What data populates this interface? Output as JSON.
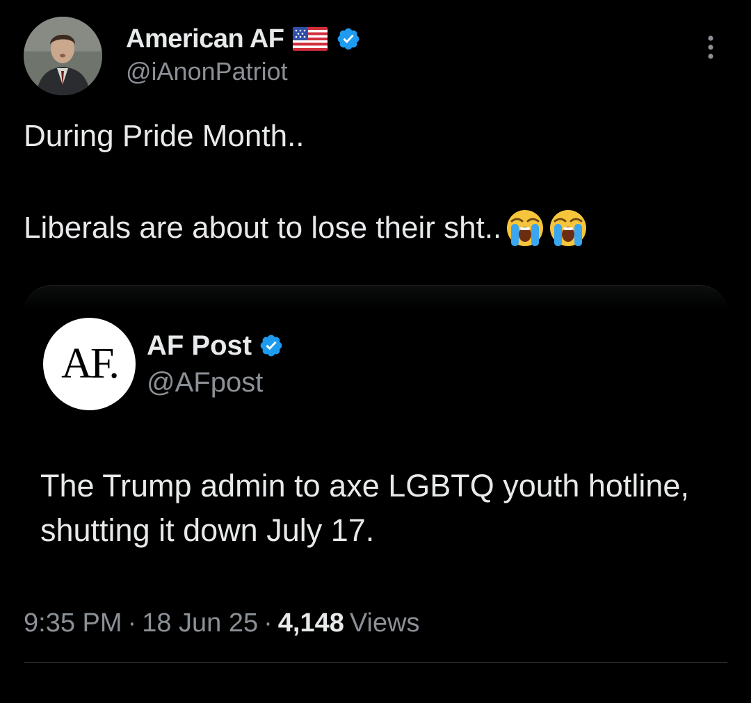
{
  "tweet": {
    "author": {
      "display_name": "American AF",
      "flag_icon": "us-flag-icon",
      "verified_icon": "verified-badge-icon",
      "handle": "@iAnonPatriot",
      "avatar_icon": "profile-photo"
    },
    "more_icon": "more-vertical-icon",
    "text_line_1": "During Pride Month..",
    "text_line_2": "Liberals are about to lose their sht..",
    "emoji": [
      "loudly-crying-face-icon",
      "loudly-crying-face-icon"
    ],
    "quoted": {
      "avatar_text": "AF.",
      "display_name": "AF Post",
      "verified_icon": "verified-badge-icon",
      "handle": "@AFpost",
      "text": "The Trump admin to axe LGBTQ youth hotline, shutting it down July 17."
    },
    "meta": {
      "time": "9:35 PM",
      "separator": "·",
      "date": "18 Jun 25",
      "views_count": "4,148",
      "views_label": "Views"
    }
  },
  "colors": {
    "background": "#000000",
    "primary_text": "#e7e9ea",
    "secondary_text": "#8b9096",
    "verified_blue": "#1d9bf0"
  }
}
